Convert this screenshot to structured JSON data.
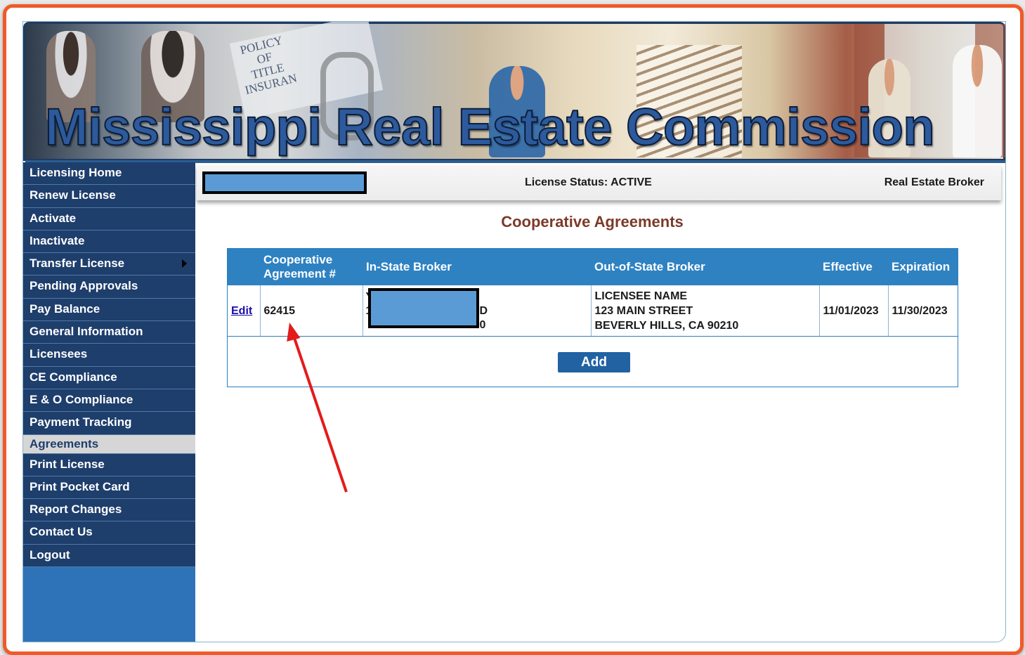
{
  "header": {
    "title": "Mississippi Real Estate Commission",
    "banner_paper_text": [
      "POLICY",
      "OF",
      "TITLE",
      "INSURAN"
    ]
  },
  "sidebar": {
    "items": [
      {
        "label": "Licensing Home"
      },
      {
        "label": "Renew License"
      },
      {
        "label": "Activate"
      },
      {
        "label": "Inactivate"
      },
      {
        "label": "Transfer License",
        "has_submenu": true
      },
      {
        "label": "Pending Approvals"
      },
      {
        "label": "Pay Balance"
      },
      {
        "label": "General Information"
      },
      {
        "label": "Licensees"
      },
      {
        "label": "CE Compliance"
      },
      {
        "label": "E & O Compliance"
      },
      {
        "label": "Payment Tracking"
      },
      {
        "label": "Agreements",
        "active": true
      },
      {
        "label": "Print License"
      },
      {
        "label": "Print Pocket Card"
      },
      {
        "label": "Report Changes"
      },
      {
        "label": "Contact Us"
      },
      {
        "label": "Logout"
      }
    ]
  },
  "status_bar": {
    "license_status": "License Status: ACTIVE",
    "license_type": "Real Estate Broker"
  },
  "main": {
    "title": "Cooperative Agreements",
    "table": {
      "headers": [
        "",
        "Cooperative Agreement #",
        "In-State Broker",
        "Out-of-State Broker",
        "Effective",
        "Expiration"
      ],
      "rows": [
        {
          "action": "Edit",
          "agreement_no": "62415",
          "in_state_fragments": [
            "Y",
            "1",
            "D",
            "0"
          ],
          "out_of_state_lines": [
            "LICENSEE NAME",
            "123 MAIN STREET",
            "BEVERLY HILLS, CA 90210"
          ],
          "effective": "11/01/2023",
          "expiration": "11/30/2023"
        }
      ]
    },
    "add_label": "Add"
  },
  "colors": {
    "frame_border": "#f05a28",
    "sidebar_bg": "#1e3e6c",
    "sidebar_fill": "#2e73b8",
    "table_header": "#2e82c2",
    "redaction": "#5b9bd5",
    "title_color": "#7b3a2a",
    "arrow": "#e41b1b"
  }
}
